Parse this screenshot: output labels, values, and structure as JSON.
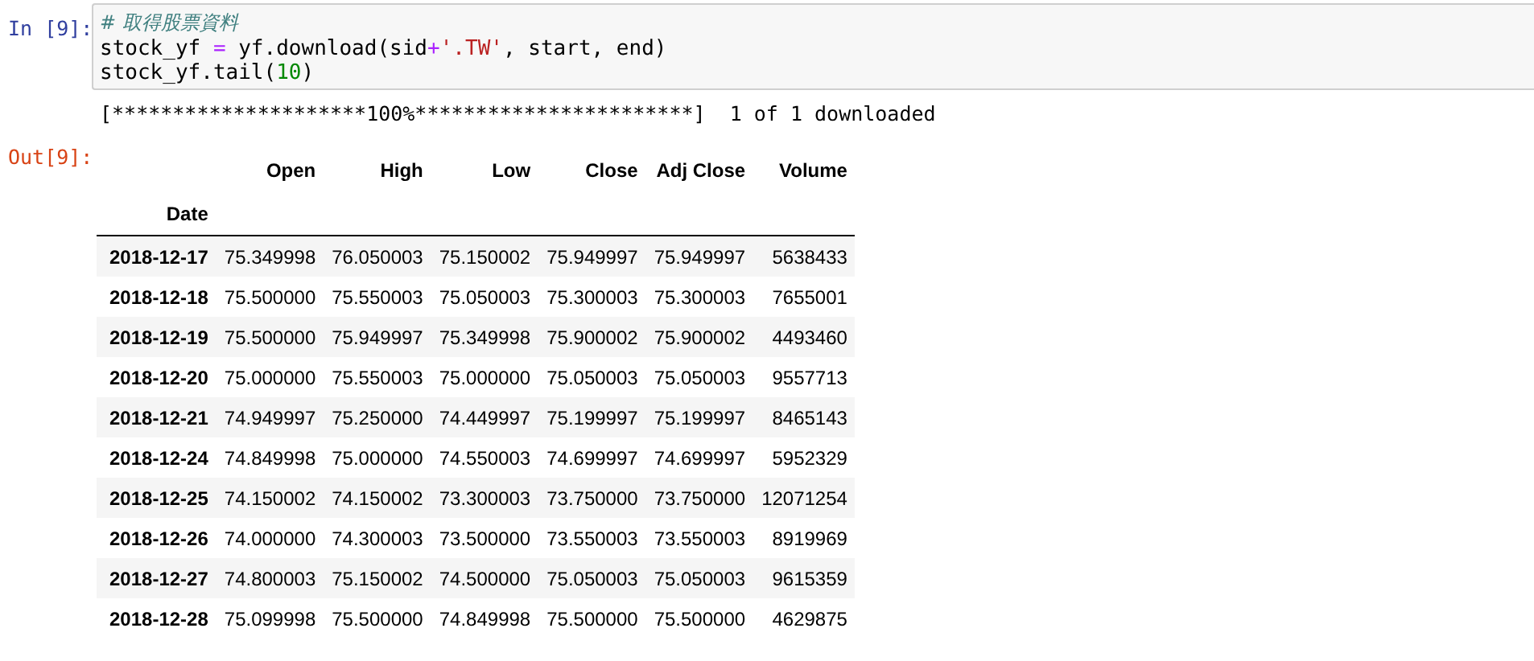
{
  "input_cell": {
    "prompt": "In [9]:",
    "lines": [
      [
        {
          "kind": "comment",
          "text": "# 取得股票資料"
        }
      ],
      [
        {
          "kind": "name",
          "text": "stock_yf "
        },
        {
          "kind": "op",
          "text": "="
        },
        {
          "kind": "name",
          "text": " yf.download"
        },
        {
          "kind": "paren",
          "text": "("
        },
        {
          "kind": "name",
          "text": "sid"
        },
        {
          "kind": "op",
          "text": "+"
        },
        {
          "kind": "str",
          "text": "'.TW'"
        },
        {
          "kind": "name",
          "text": ", start, end"
        },
        {
          "kind": "paren",
          "text": ")"
        }
      ],
      [
        {
          "kind": "name",
          "text": "stock_yf.tail("
        },
        {
          "kind": "num",
          "text": "10"
        },
        {
          "kind": "name",
          "text": ")"
        }
      ]
    ]
  },
  "stream_output": "[*********************100%***********************]  1 of 1 downloaded",
  "output_cell": {
    "prompt": "Out[9]:",
    "table": {
      "columns": [
        "Open",
        "High",
        "Low",
        "Close",
        "Adj Close",
        "Volume"
      ],
      "index_name": "Date",
      "rows": [
        {
          "index": "2018-12-17",
          "cells": [
            "75.349998",
            "76.050003",
            "75.150002",
            "75.949997",
            "75.949997",
            "5638433"
          ]
        },
        {
          "index": "2018-12-18",
          "cells": [
            "75.500000",
            "75.550003",
            "75.050003",
            "75.300003",
            "75.300003",
            "7655001"
          ]
        },
        {
          "index": "2018-12-19",
          "cells": [
            "75.500000",
            "75.949997",
            "75.349998",
            "75.900002",
            "75.900002",
            "4493460"
          ]
        },
        {
          "index": "2018-12-20",
          "cells": [
            "75.000000",
            "75.550003",
            "75.000000",
            "75.050003",
            "75.050003",
            "9557713"
          ]
        },
        {
          "index": "2018-12-21",
          "cells": [
            "74.949997",
            "75.250000",
            "74.449997",
            "75.199997",
            "75.199997",
            "8465143"
          ]
        },
        {
          "index": "2018-12-24",
          "cells": [
            "74.849998",
            "75.000000",
            "74.550003",
            "74.699997",
            "74.699997",
            "5952329"
          ]
        },
        {
          "index": "2018-12-25",
          "cells": [
            "74.150002",
            "74.150002",
            "73.300003",
            "73.750000",
            "73.750000",
            "12071254"
          ]
        },
        {
          "index": "2018-12-26",
          "cells": [
            "74.000000",
            "74.300003",
            "73.500000",
            "73.550003",
            "73.550003",
            "8919969"
          ]
        },
        {
          "index": "2018-12-27",
          "cells": [
            "74.800003",
            "75.150002",
            "74.500000",
            "75.050003",
            "75.050003",
            "9615359"
          ]
        },
        {
          "index": "2018-12-28",
          "cells": [
            "75.099998",
            "75.500000",
            "74.849998",
            "75.500000",
            "75.500000",
            "4629875"
          ]
        }
      ]
    }
  }
}
